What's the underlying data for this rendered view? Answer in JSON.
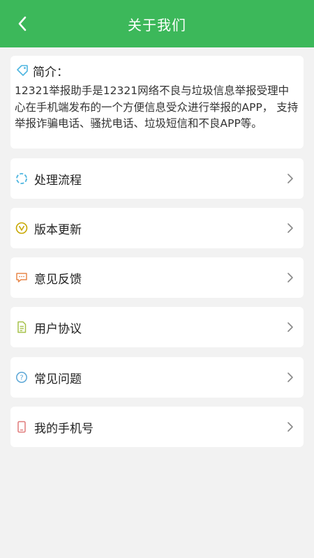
{
  "header": {
    "title": "关于我们",
    "back_icon": "back-arrow-icon",
    "background_color": "#3cb85a"
  },
  "intro": {
    "icon": "tag-icon",
    "label": "简介：",
    "text": "12321举报助手是12321网络不良与垃圾信息举报受理中心在手机端发布的一个方便信息受众进行举报的APP，  支持举报诈骗电话、骚扰电话、垃圾短信和不良APP等。"
  },
  "menu": {
    "items": [
      {
        "label": "处理流程",
        "icon": "process-circle-icon",
        "color": "#4fb6e0"
      },
      {
        "label": "版本更新",
        "icon": "version-v-icon",
        "color": "#c8a800"
      },
      {
        "label": "意见反馈",
        "icon": "feedback-bubble-icon",
        "color": "#e8874a"
      },
      {
        "label": "用户协议",
        "icon": "document-icon",
        "color": "#a6c24a"
      },
      {
        "label": "常见问题",
        "icon": "question-circle-icon",
        "color": "#5aa6d6"
      },
      {
        "label": "我的手机号",
        "icon": "phone-icon",
        "color": "#e07a7a"
      }
    ]
  }
}
